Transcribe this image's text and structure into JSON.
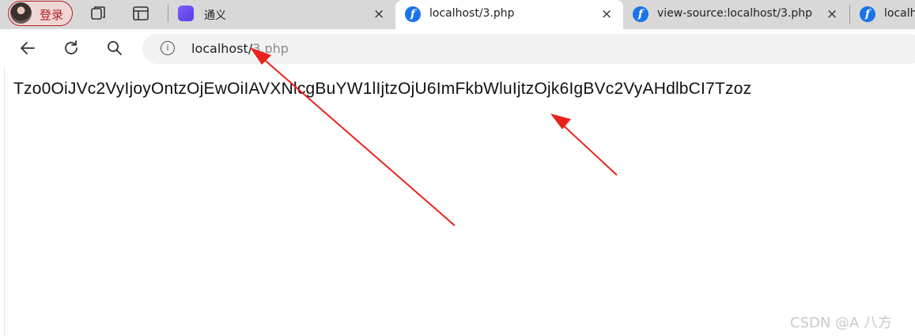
{
  "profile": {
    "label": "登录"
  },
  "tabs": [
    {
      "title": "通义",
      "close": "×",
      "favicon": "tongyi-icon"
    },
    {
      "title": "localhost/3.php",
      "close": "×",
      "favicon": "f-icon",
      "active": true
    },
    {
      "title": "view-source:localhost/3.php",
      "close": "×",
      "favicon": "f-icon"
    },
    {
      "title": "localh",
      "favicon": "f-icon"
    }
  ],
  "address": {
    "host": "localhost/",
    "path": "3.php"
  },
  "page": {
    "payload": "Tzo0OiJVc2VyIjoyOntzOjEwOiIAVXNlcgBuYW1lIjtzOjU6ImFkbWluIjtzOjk6IgBVc2VyAHdlbCI7Tzoz"
  },
  "watermark": "CSDN @A  八方",
  "icons": [
    "back-arrow-icon",
    "reload-icon",
    "search-icon",
    "info-icon",
    "tabs-icon",
    "sidebar-icon",
    "collections-icon"
  ],
  "colors": {
    "annotation": "#e8231c",
    "profile_border": "#b22222",
    "tab_strip": "#d8d8d8"
  }
}
